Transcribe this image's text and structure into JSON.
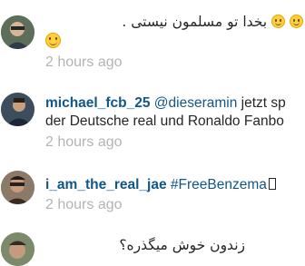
{
  "comments": [
    {
      "username": "",
      "text": "بخدا تو مسلمون نیستی .",
      "time": "2 hours ago",
      "avatar_icon": "user-avatar-icon"
    },
    {
      "username": "michael_fcb_25",
      "mention": "@dieseramin",
      "text": "jetzt sp",
      "text_line2": "der Deutsche real und Ronaldo Fanbo",
      "time": "2 hours ago",
      "avatar_icon": "user-avatar-icon"
    },
    {
      "username": "i_am_the_real_jae",
      "hashtag": "#FreeBenzema",
      "time": "2 hours ago",
      "avatar_icon": "user-avatar-icon"
    },
    {
      "username": "",
      "text": "زندون خوش میگذره؟",
      "avatar_icon": "user-avatar-icon"
    }
  ],
  "colors": {
    "username": "#125688",
    "text": "#262626",
    "timestamp": "#b4b4b4",
    "emoji": "#ffcf3f"
  }
}
